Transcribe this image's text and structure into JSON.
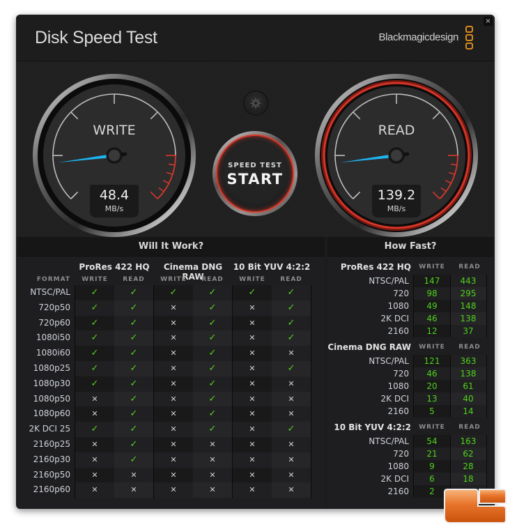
{
  "window": {
    "title": "Disk Speed Test",
    "brand": "Blackmagicdesign",
    "close_label": "×"
  },
  "gauges": {
    "write": {
      "label": "WRITE",
      "value": "48.4",
      "unit": "MB/s",
      "needle_fraction": 0.14
    },
    "read": {
      "label": "READ",
      "value": "139.2",
      "unit": "MB/s",
      "needle_fraction": 0.14
    }
  },
  "controls": {
    "settings_icon": "gear-icon",
    "start_small": "SPEED TEST",
    "start_big": "START"
  },
  "colors": {
    "accent_red": "#d8382a",
    "needle_blue": "#1eb4f0",
    "ok_green": "#56d41d",
    "brand_orange": "#d98a1e"
  },
  "will_it_work": {
    "title": "Will It Work?",
    "format_header": "FORMAT",
    "codecs": [
      "ProRes 422 HQ",
      "Cinema DNG RAW",
      "10 Bit YUV 4:2:2"
    ],
    "sub_headers": [
      "WRITE",
      "READ",
      "WRITE",
      "READ",
      "WRITE",
      "READ"
    ],
    "rows": [
      {
        "format": "NTSC/PAL",
        "cells": [
          "ok",
          "ok",
          "ok",
          "ok",
          "ok",
          "ok"
        ]
      },
      {
        "format": "720p50",
        "cells": [
          "ok",
          "ok",
          "no",
          "ok",
          "no",
          "ok"
        ]
      },
      {
        "format": "720p60",
        "cells": [
          "ok",
          "ok",
          "no",
          "ok",
          "no",
          "ok"
        ]
      },
      {
        "format": "1080i50",
        "cells": [
          "ok",
          "ok",
          "no",
          "ok",
          "no",
          "ok"
        ]
      },
      {
        "format": "1080i60",
        "cells": [
          "ok",
          "ok",
          "no",
          "ok",
          "no",
          "no"
        ]
      },
      {
        "format": "1080p25",
        "cells": [
          "ok",
          "ok",
          "no",
          "ok",
          "no",
          "ok"
        ]
      },
      {
        "format": "1080p30",
        "cells": [
          "ok",
          "ok",
          "no",
          "ok",
          "no",
          "no"
        ]
      },
      {
        "format": "1080p50",
        "cells": [
          "no",
          "ok",
          "no",
          "ok",
          "no",
          "no"
        ]
      },
      {
        "format": "1080p60",
        "cells": [
          "no",
          "ok",
          "no",
          "ok",
          "no",
          "no"
        ]
      },
      {
        "format": "2K DCI 25",
        "cells": [
          "ok",
          "ok",
          "no",
          "ok",
          "no",
          "ok"
        ]
      },
      {
        "format": "2160p25",
        "cells": [
          "no",
          "ok",
          "no",
          "no",
          "no",
          "no"
        ]
      },
      {
        "format": "2160p30",
        "cells": [
          "no",
          "ok",
          "no",
          "no",
          "no",
          "no"
        ]
      },
      {
        "format": "2160p50",
        "cells": [
          "no",
          "no",
          "no",
          "no",
          "no",
          "no"
        ]
      },
      {
        "format": "2160p60",
        "cells": [
          "no",
          "no",
          "no",
          "no",
          "no",
          "no"
        ]
      }
    ],
    "ok_glyph": "✓",
    "no_glyph": "✕"
  },
  "how_fast": {
    "title": "How Fast?",
    "write_header": "WRITE",
    "read_header": "READ",
    "sections": [
      {
        "codec": "ProRes 422 HQ",
        "rows": [
          {
            "format": "NTSC/PAL",
            "write": "147",
            "read": "443"
          },
          {
            "format": "720",
            "write": "98",
            "read": "295"
          },
          {
            "format": "1080",
            "write": "49",
            "read": "148"
          },
          {
            "format": "2K DCI",
            "write": "46",
            "read": "138"
          },
          {
            "format": "2160",
            "write": "12",
            "read": "37"
          }
        ]
      },
      {
        "codec": "Cinema DNG RAW",
        "rows": [
          {
            "format": "NTSC/PAL",
            "write": "121",
            "read": "363"
          },
          {
            "format": "720",
            "write": "46",
            "read": "138"
          },
          {
            "format": "1080",
            "write": "20",
            "read": "61"
          },
          {
            "format": "2K DCI",
            "write": "13",
            "read": "40"
          },
          {
            "format": "2160",
            "write": "5",
            "read": "14"
          }
        ]
      },
      {
        "codec": "10 Bit YUV 4:2:2",
        "rows": [
          {
            "format": "NTSC/PAL",
            "write": "54",
            "read": "163"
          },
          {
            "format": "720",
            "write": "21",
            "read": "62"
          },
          {
            "format": "1080",
            "write": "9",
            "read": "28"
          },
          {
            "format": "2K DCI",
            "write": "6",
            "read": "18"
          },
          {
            "format": "2160",
            "write": "2",
            "read": ""
          }
        ]
      }
    ]
  }
}
